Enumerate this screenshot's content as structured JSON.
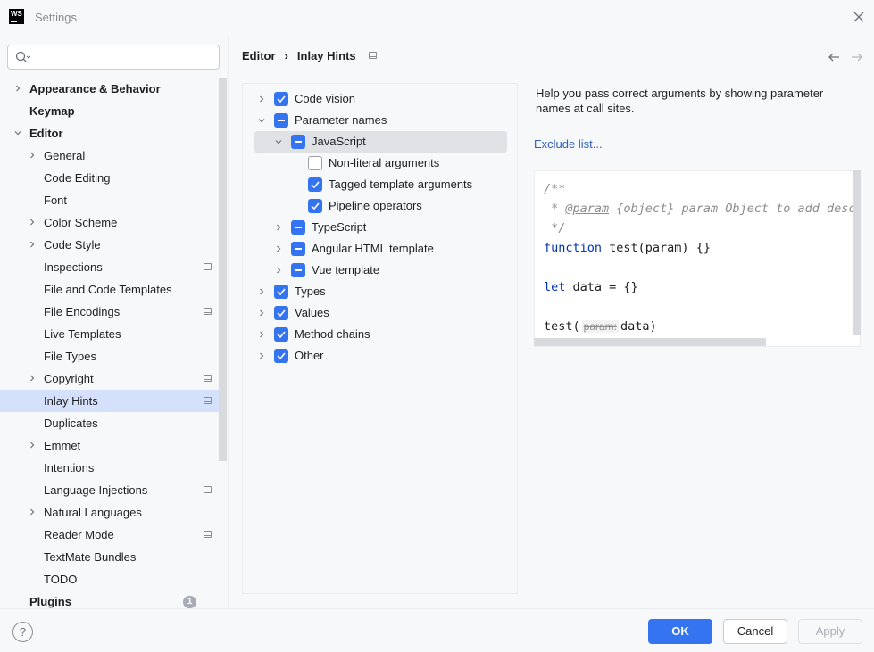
{
  "window": {
    "title": "Settings",
    "logo_text": "WS"
  },
  "search": {
    "placeholder": "",
    "value": ""
  },
  "sidebar": {
    "items": [
      {
        "label": "Appearance & Behavior",
        "bold": true,
        "chevron": "right"
      },
      {
        "label": "Keymap",
        "bold": true,
        "chevron": "none"
      },
      {
        "label": "Editor",
        "bold": true,
        "chevron": "down"
      },
      {
        "label": "General",
        "chevron": "right"
      },
      {
        "label": "Code Editing"
      },
      {
        "label": "Font"
      },
      {
        "label": "Color Scheme",
        "chevron": "right"
      },
      {
        "label": "Code Style",
        "chevron": "right"
      },
      {
        "label": "Inspections",
        "project_icon": true
      },
      {
        "label": "File and Code Templates"
      },
      {
        "label": "File Encodings",
        "project_icon": true
      },
      {
        "label": "Live Templates"
      },
      {
        "label": "File Types"
      },
      {
        "label": "Copyright",
        "chevron": "right",
        "project_icon": true
      },
      {
        "label": "Inlay Hints",
        "selected": true,
        "project_icon": true
      },
      {
        "label": "Duplicates"
      },
      {
        "label": "Emmet",
        "chevron": "right"
      },
      {
        "label": "Intentions"
      },
      {
        "label": "Language Injections",
        "project_icon": true
      },
      {
        "label": "Natural Languages",
        "chevron": "right"
      },
      {
        "label": "Reader Mode",
        "project_icon": true
      },
      {
        "label": "TextMate Bundles"
      },
      {
        "label": "TODO"
      },
      {
        "label": "Plugins",
        "bold": true,
        "badge": "1"
      }
    ]
  },
  "breadcrumb": {
    "parent": "Editor",
    "separator": "›",
    "current": "Inlay Hints"
  },
  "hints": {
    "rows": [
      {
        "label": "Code vision",
        "state": "checked",
        "chevron": "right",
        "level": 0
      },
      {
        "label": "Parameter names",
        "state": "partial",
        "chevron": "down",
        "level": 0
      },
      {
        "label": "JavaScript",
        "state": "partial",
        "chevron": "down",
        "level": 1,
        "selected": true
      },
      {
        "label": "Non-literal arguments",
        "state": "unchecked",
        "level": 2
      },
      {
        "label": "Tagged template arguments",
        "state": "checked",
        "level": 2
      },
      {
        "label": "Pipeline operators",
        "state": "checked",
        "level": 2
      },
      {
        "label": "TypeScript",
        "state": "partial",
        "chevron": "right",
        "level": 1
      },
      {
        "label": "Angular HTML template",
        "state": "partial",
        "chevron": "right",
        "level": 1
      },
      {
        "label": "Vue template",
        "state": "partial",
        "chevron": "right",
        "level": 1
      },
      {
        "label": "Types",
        "state": "checked",
        "chevron": "right",
        "level": 0
      },
      {
        "label": "Values",
        "state": "checked",
        "chevron": "right",
        "level": 0
      },
      {
        "label": "Method chains",
        "state": "checked",
        "chevron": "right",
        "level": 0
      },
      {
        "label": "Other",
        "state": "checked",
        "chevron": "right",
        "level": 0
      }
    ]
  },
  "description": {
    "text": "Help you pass correct arguments by showing parameter names at call sites.",
    "exclude_link": "Exclude list..."
  },
  "code": {
    "line1": "/**",
    "line2_prefix": " * ",
    "line2_tag": "@param",
    "line2_rest": " {object} param Object to add descri",
    "line3": " */",
    "line4_kw": "function",
    "line4_rest": " test(param) {}",
    "line5_kw": "let",
    "line5_rest": " data = {}",
    "line6_prefix": "test(",
    "line6_hint": "param:",
    "line6_rest": "data)"
  },
  "buttons": {
    "help": "?",
    "ok": "OK",
    "cancel": "Cancel",
    "apply": "Apply"
  },
  "colors": {
    "accent": "#3574f0",
    "selection": "#d5e1fa",
    "link": "#2f5fbf",
    "keyword": "#0033b3"
  }
}
